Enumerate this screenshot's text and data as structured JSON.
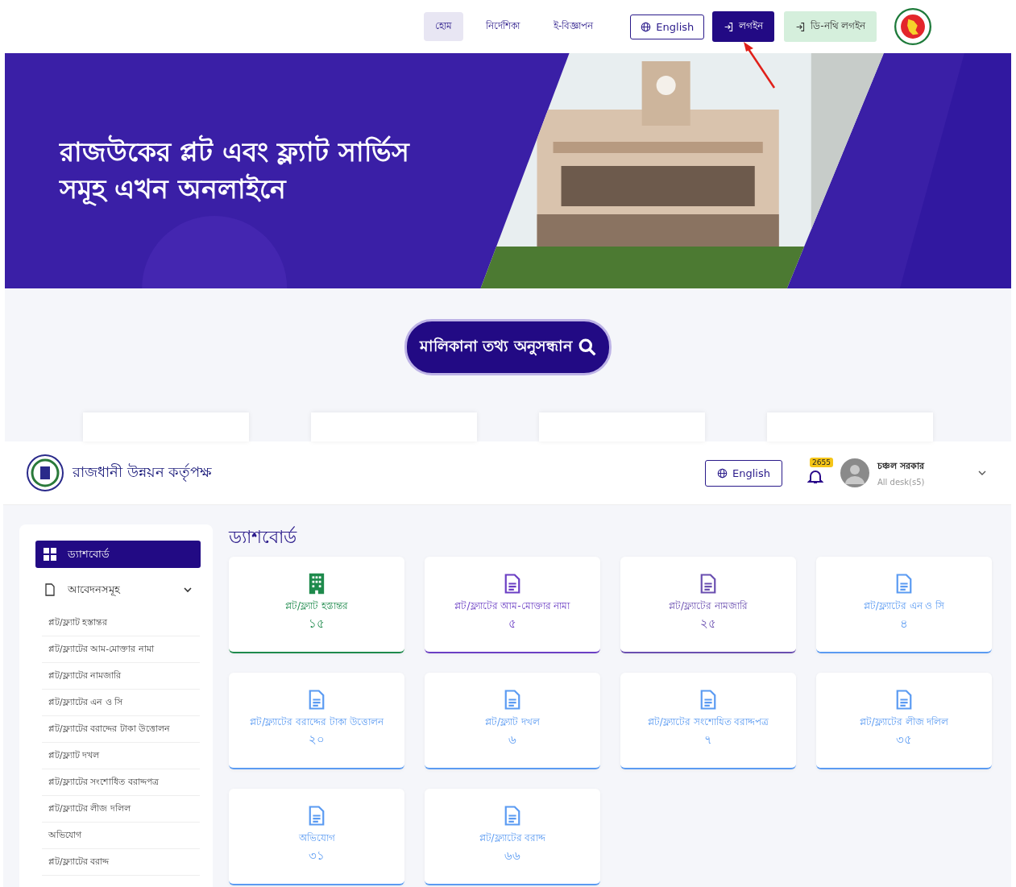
{
  "top_nav": {
    "links": [
      {
        "label": "হোম",
        "selected": true
      },
      {
        "label": "নির্দেশিকা",
        "selected": false
      },
      {
        "label": "ই-বিজ্ঞাপন",
        "selected": false
      }
    ],
    "language_button": "English",
    "login_button": "লগইন",
    "dnothi_login_button": "ডি-নথি লগইন"
  },
  "banner": {
    "headline_lines": [
      "রাজউকের প্লট এবং ফ্ল্যাট সার্ভিস",
      "সমূহ এখন অনলাইনে"
    ]
  },
  "search_button": "মালিকানা তথ্য অনুসন্ধান",
  "dashboard_header": {
    "org_name": "রাজধানী উন্নয়ন কর্তৃপক্ষ",
    "language_button": "English",
    "notification_count": "2655",
    "user_name": "চঞ্চল সরকার",
    "user_role": "All desk(s5)"
  },
  "sidebar": {
    "items": [
      {
        "label": "ড্যাশবোর্ড",
        "kind": "dashboard",
        "selected": true
      },
      {
        "label": "আবেদনসমূহ",
        "kind": "group",
        "selected": false,
        "expanded": true,
        "children": [
          {
            "label": "প্লট/ফ্ল্যাট হস্তান্তর"
          },
          {
            "label": "প্লট/ফ্ল্যাটের আম-মোক্তার নামা"
          },
          {
            "label": "প্লট/ফ্ল্যাটের নামজারি"
          },
          {
            "label": "প্লট/ফ্ল্যাটের এন ও সি"
          },
          {
            "label": "প্লট/ফ্ল্যাটের বরাদ্দের টাকা উত্তোলন"
          },
          {
            "label": "প্লট/ফ্ল্যাট দখল"
          },
          {
            "label": "প্লট/ফ্ল্যাটের সংশোধিত বরাদ্দপত্র"
          },
          {
            "label": "প্লট/ফ্ল্যাটের লীজ দলিল"
          },
          {
            "label": "অভিযোগ"
          },
          {
            "label": "প্লট/ফ্ল্যাটের বরাদ্দ"
          }
        ]
      }
    ]
  },
  "page_title": "ড্যাশবোর্ড",
  "cards": [
    {
      "label": "প্লট/ফ্ল্যাট হস্তান্তর",
      "count": "১৫",
      "kind": "building",
      "color": "#1e8a4c"
    },
    {
      "label": "প্লট/ফ্ল্যাটের আম-মোক্তার নামা",
      "count": "৫",
      "kind": "document",
      "color": "#6b3fc4"
    },
    {
      "label": "প্লট/ফ্ল্যাটের নামজারি",
      "count": "২৫",
      "kind": "document",
      "color": "#6a4fb0"
    },
    {
      "label": "প্লট/ফ্ল্যাটের এন ও সি",
      "count": "৪",
      "kind": "document",
      "color": "#5b9bf2"
    },
    {
      "label": "প্লট/ফ্ল্যাটের বরাদ্দের টাকা উত্তোলন",
      "count": "২০",
      "kind": "document",
      "color": "#5b9bf2"
    },
    {
      "label": "প্লট/ফ্ল্যাট দখল",
      "count": "৬",
      "kind": "document",
      "color": "#5b9bf2"
    },
    {
      "label": "প্লট/ফ্ল্যাটের সংশোধিত বরাদ্দপত্র",
      "count": "৭",
      "kind": "document",
      "color": "#5b9bf2"
    },
    {
      "label": "প্লট/ফ্ল্যাটের লীজ দলিল",
      "count": "৩৫",
      "kind": "document",
      "color": "#5b9bf2"
    },
    {
      "label": "অভিযোগ",
      "count": "৩১",
      "kind": "document",
      "color": "#5b9bf2"
    },
    {
      "label": "প্লট/ফ্ল্যাটের বরাদ্দ",
      "count": "৬৬",
      "kind": "document",
      "color": "#5b9bf2"
    }
  ]
}
